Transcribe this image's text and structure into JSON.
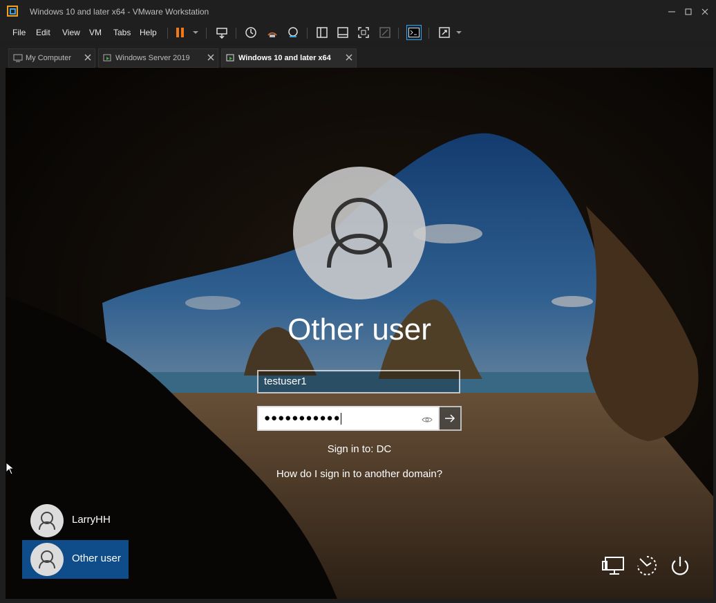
{
  "window": {
    "title": "Windows 10 and later x64 - VMware Workstation"
  },
  "menu": {
    "items": [
      "File",
      "Edit",
      "View",
      "VM",
      "Tabs",
      "Help"
    ]
  },
  "tabs": [
    {
      "label": "My Computer",
      "active": false
    },
    {
      "label": "Windows Server 2019",
      "active": false
    },
    {
      "label": "Windows 10 and later x64",
      "active": true
    }
  ],
  "login": {
    "heading": "Other user",
    "username_value": "testuser1",
    "password_mask": "●●●●●●●●●●●",
    "sign_in_to": "Sign in to: DC",
    "another_domain_link": "How do I sign in to another domain?"
  },
  "users": [
    {
      "name": "LarryHH",
      "selected": false
    },
    {
      "name": "Other user",
      "selected": true
    }
  ],
  "colors": {
    "accent_pause": "#f07818",
    "selected_user": "#0e4d8a",
    "chrome_bg": "#1f1f1f"
  },
  "icons": [
    "network-icon",
    "ease-of-access-icon",
    "power-icon"
  ]
}
